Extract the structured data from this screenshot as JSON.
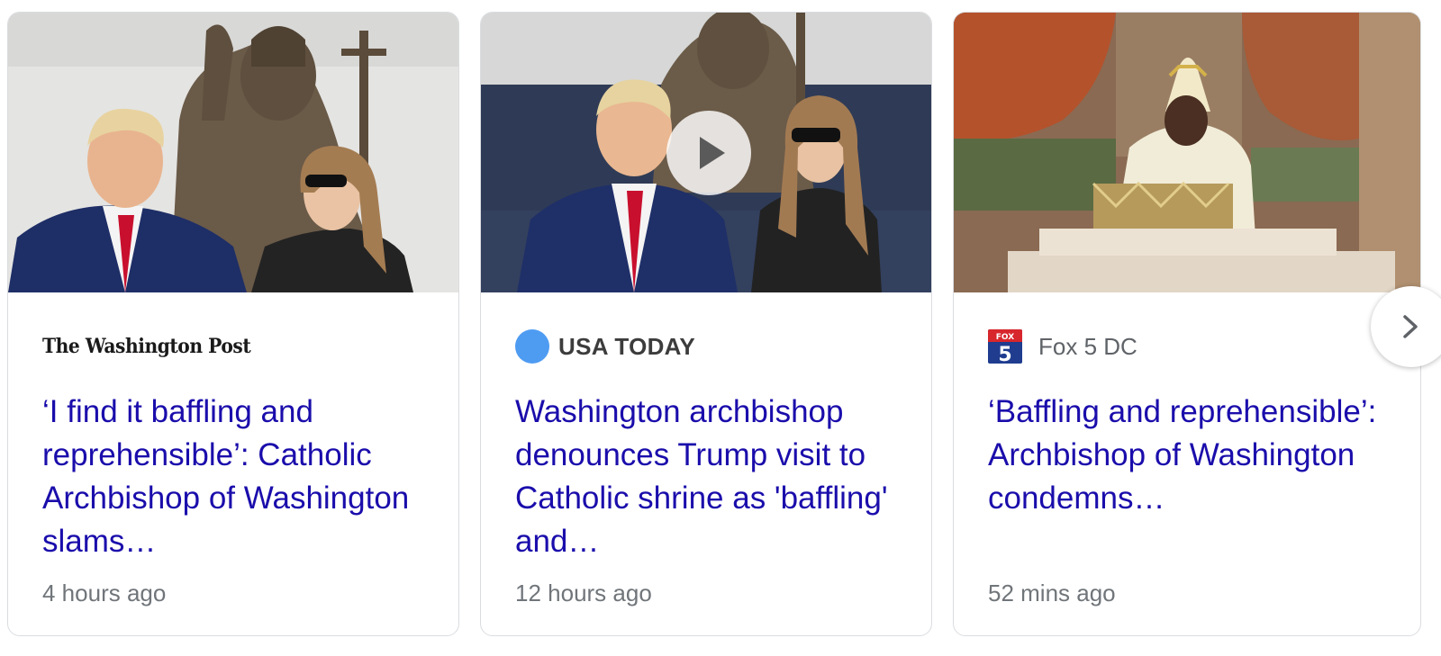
{
  "cards": [
    {
      "source": "The Washington Post",
      "headline": "‘I find it baffling and reprehensible’: Catholic Archbishop of Washington slams…",
      "time": "4 hours ago",
      "has_video": false
    },
    {
      "source": "USA TODAY",
      "headline": "Washington archbishop denounces Trump visit to Catholic shrine as 'baffling' and…",
      "time": "12 hours ago",
      "has_video": true,
      "source_logo_color": "#4e9bf2"
    },
    {
      "source": "Fox 5 DC",
      "headline": "‘Baffling and reprehensible’: Archbishop of Washington condemns…",
      "time": "52 mins ago",
      "has_video": false,
      "source_icon_text": "FOX 5"
    }
  ],
  "colors": {
    "headline": "#1a0dab",
    "meta": "#70757a",
    "border": "#dadce0"
  },
  "icons": {
    "play": "play-icon",
    "next": "chevron-right-icon"
  }
}
